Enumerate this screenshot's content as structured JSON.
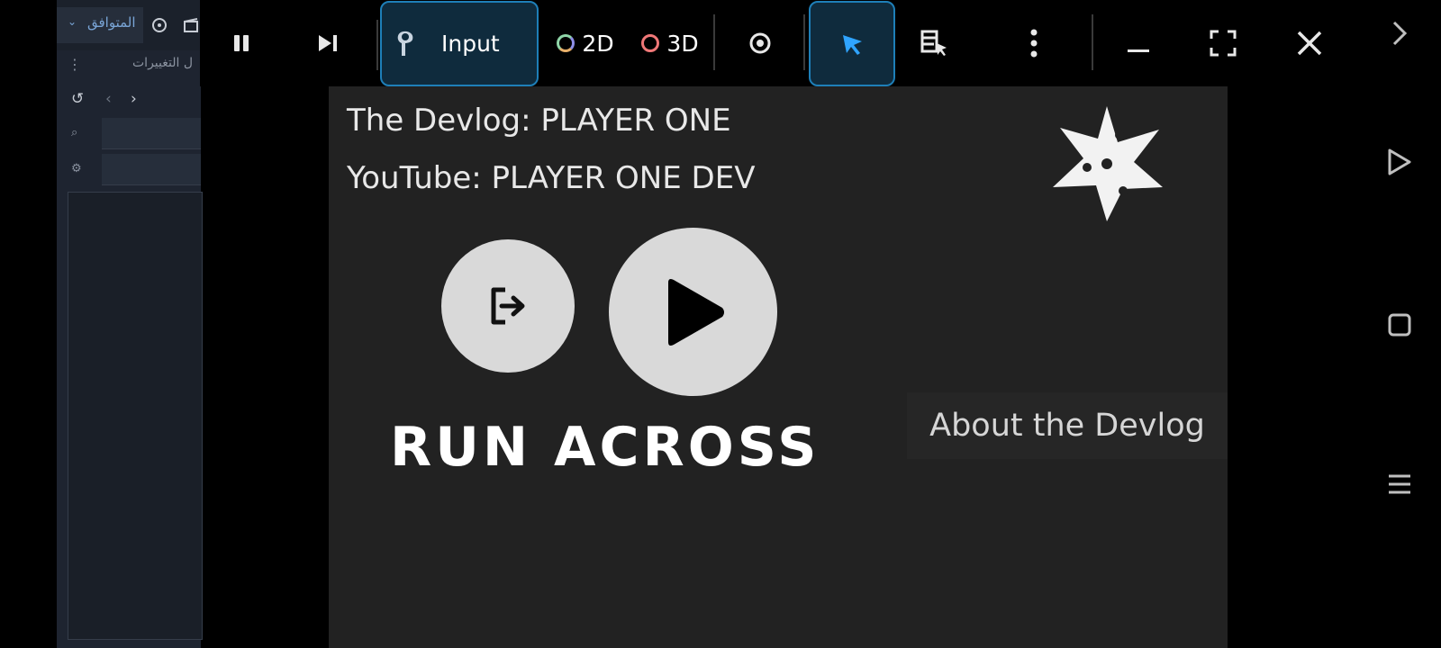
{
  "editor": {
    "compat_label": "المتوافق",
    "dock_title": "ل التغييرات",
    "nav_prev": "‹",
    "nav_next": "›",
    "menu_dots": "⋮"
  },
  "toolbar": {
    "input_label": "Input",
    "mode_2d_label": "2D",
    "mode_3d_label": "3D",
    "colors": {
      "active_bg": "#0f2b3d",
      "active_border": "#1e7fb8",
      "accent": "#2fa4ff"
    }
  },
  "viewport": {
    "devlog_line": "The Devlog: PLAYER ONE",
    "youtube_line": "YouTube: PLAYER ONE DEV",
    "game_title": "RUN ACROSS",
    "about_button": "About the Devlog"
  },
  "icons": {
    "pause": "pause-icon",
    "step": "step-forward-icon",
    "input": "input-probe-icon",
    "eye": "eye-icon",
    "select": "select-cursor-icon",
    "list_select": "list-select-icon",
    "more": "more-vertical-icon",
    "minimize": "minimize-icon",
    "fullscreen": "fullscreen-icon",
    "close": "close-icon",
    "exit": "exit-icon",
    "play": "play-icon",
    "shuriken": "shuriken-logo"
  }
}
